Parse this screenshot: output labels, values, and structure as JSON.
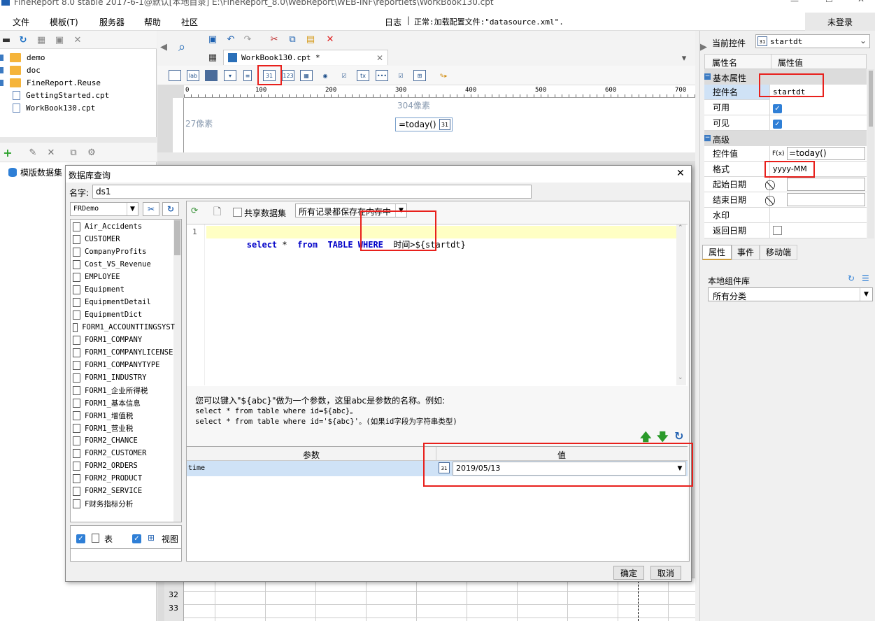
{
  "window": {
    "title": "FineReport 8.0 stable 2017-6-1@默认[本地目录]    E:\\FineReport_8.0\\WebReport\\WEB-INF\\reportlets\\WorkBook130.cpt",
    "login": "未登录"
  },
  "menu": [
    "文件",
    "模板(T)",
    "服务器",
    "帮助",
    "社区"
  ],
  "status": {
    "log": "日志",
    "message": "正常:加载配置文件:\"datasource.xml\"."
  },
  "file_tree": [
    {
      "name": "demo",
      "type": "folder"
    },
    {
      "name": "doc",
      "type": "folder"
    },
    {
      "name": "FineReport.Reuse",
      "type": "folder"
    },
    {
      "name": "GettingStarted.cpt",
      "type": "file"
    },
    {
      "name": "WorkBook130.cpt",
      "type": "file"
    }
  ],
  "dataset_panel": {
    "root": "模版数据集"
  },
  "editor": {
    "tab": "WorkBook130.cpt *",
    "ruler_marks": [
      "0",
      "100",
      "200",
      "300",
      "400",
      "500",
      "600",
      "700"
    ],
    "label_x": "304像素",
    "label_y": "27像素",
    "widget_value": "=today()",
    "row_numbers": [
      "32",
      "33"
    ]
  },
  "dialog": {
    "title": "数据库查询",
    "name_label": "名字:",
    "name_value": "ds1",
    "connection": "FRDemo",
    "share_label": "共享数据集",
    "cache_mode": "所有记录都保存在内存中",
    "line_no": "1",
    "sql_kw1": "select",
    "sql_star": " * ",
    "sql_kw2": "from",
    "sql_kw3": "TABLE WHERE",
    "sql_rest": " 时间>${startdt}",
    "tables": [
      "Air_Accidents",
      "CUSTOMER",
      "CompanyProfits",
      "Cost_VS_Revenue",
      "EMPLOYEE",
      "Equipment",
      "EquipmentDetail",
      "EquipmentDict",
      "FORM1_ACCOUNTTINGSYST",
      "FORM1_COMPANY",
      "FORM1_COMPANYLICENSE",
      "FORM1_COMPANYTYPE",
      "FORM1_INDUSTRY",
      "FORM1_企业所得税",
      "FORM1_基本信息",
      "FORM1_增值税",
      "FORM1_营业税",
      "FORM2_CHANCE",
      "FORM2_CUSTOMER",
      "FORM2_ORDERS",
      "FORM2_PRODUCT",
      "FORM2_SERVICE",
      "F财务指标分析"
    ],
    "table_check": "表",
    "view_check": "视图",
    "hint1": "您可以键入\"${abc}\"做为一个参数，这里abc是参数的名称。例如:",
    "hint2": "select * from table where id=${abc}。",
    "hint3": "select * from table where id='${abc}'。(如果id字段为字符串类型)",
    "param_header": "参数",
    "value_header": "值",
    "param_name": "time",
    "param_value": "2019/05/13",
    "ok": "确定",
    "cancel": "取消"
  },
  "props": {
    "current_label": "当前控件",
    "current_value": "startdt",
    "col_name": "属性名",
    "col_value": "属性值",
    "section_basic": "基本属性",
    "section_adv": "高级",
    "rows": {
      "name_k": "控件名",
      "name_v": "startdt",
      "enabled_k": "可用",
      "visible_k": "可见",
      "value_k": "控件值",
      "value_v": "=today()",
      "fx": "F(x)",
      "format_k": "格式",
      "format_v": "yyyy-MM",
      "start_k": "起始日期",
      "end_k": "结束日期",
      "watermark_k": "水印",
      "return_k": "返回日期"
    },
    "tabs": [
      "属性",
      "事件",
      "移动端"
    ],
    "lib_title": "本地组件库",
    "lib_category": "所有分类"
  }
}
